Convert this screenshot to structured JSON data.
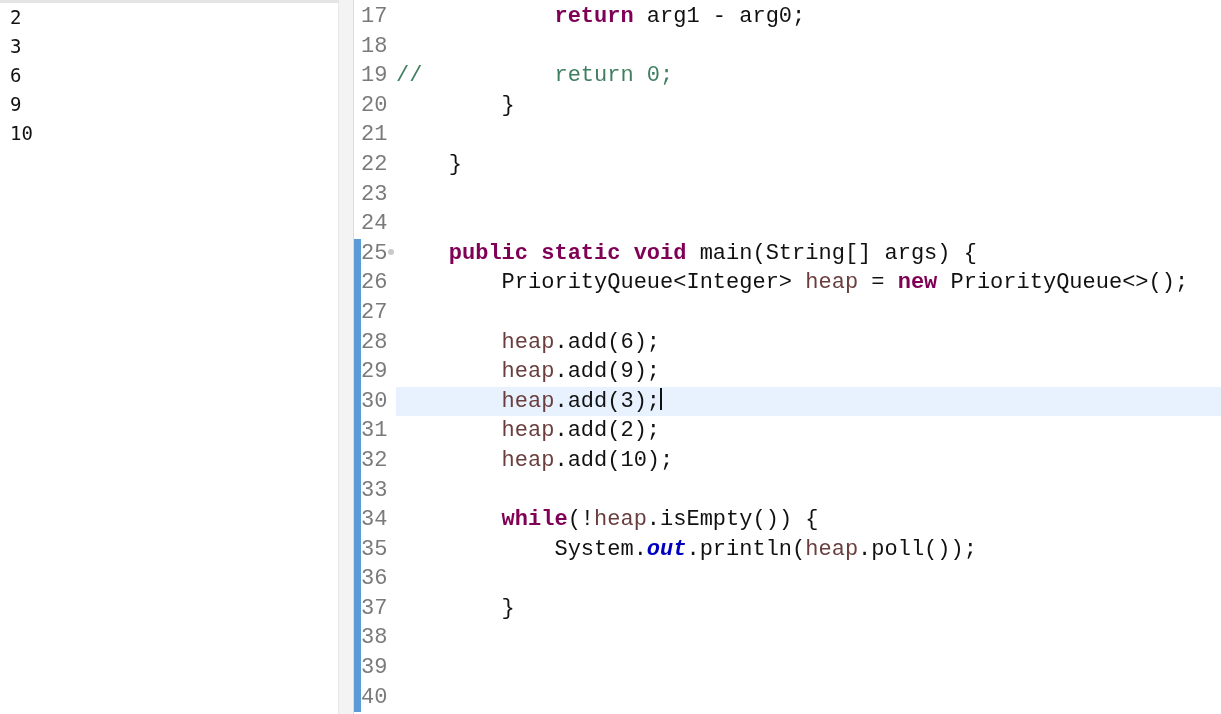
{
  "console": {
    "lines": [
      "2",
      "3",
      "6",
      "9",
      "10"
    ]
  },
  "editor": {
    "lines": [
      {
        "number": "17",
        "selected": false,
        "changed": false,
        "foldable": false,
        "tokens": [
          {
            "kind": "keyword",
            "text": "            return"
          },
          {
            "kind": "plain",
            "text": " arg1 - arg0;"
          }
        ]
      },
      {
        "number": "18",
        "selected": false,
        "changed": false,
        "foldable": false
      },
      {
        "number": "19",
        "selected": false,
        "changed": false,
        "foldable": false,
        "tokens": [
          {
            "kind": "comment",
            "text": "//          return 0;"
          }
        ]
      },
      {
        "number": "20",
        "selected": false,
        "changed": false,
        "foldable": false,
        "tokens": [
          {
            "kind": "plain",
            "text": "        }"
          }
        ]
      },
      {
        "number": "21",
        "selected": false,
        "changed": false,
        "foldable": false
      },
      {
        "number": "22",
        "selected": false,
        "changed": false,
        "foldable": false,
        "tokens": [
          {
            "kind": "plain",
            "text": "    }"
          }
        ]
      },
      {
        "number": "23",
        "selected": false,
        "changed": false,
        "foldable": false
      },
      {
        "number": "24",
        "selected": false,
        "changed": false,
        "foldable": false
      },
      {
        "number": "25",
        "selected": false,
        "changed": true,
        "foldable": true,
        "tokens": [
          {
            "kind": "keyword",
            "text": "    public static void"
          },
          {
            "kind": "plain",
            "text": " main(String[] args) {"
          }
        ]
      },
      {
        "number": "26",
        "selected": false,
        "changed": true,
        "foldable": false,
        "tokens": [
          {
            "kind": "plain",
            "text": "        PriorityQueue<Integer> "
          },
          {
            "kind": "local",
            "text": "heap"
          },
          {
            "kind": "plain",
            "text": " = "
          },
          {
            "kind": "keyword",
            "text": "new"
          },
          {
            "kind": "plain",
            "text": " PriorityQueue<>();"
          }
        ]
      },
      {
        "number": "27",
        "selected": false,
        "changed": true,
        "foldable": false
      },
      {
        "number": "28",
        "selected": false,
        "changed": true,
        "foldable": false,
        "tokens": [
          {
            "kind": "local",
            "text": "        heap"
          },
          {
            "kind": "plain",
            "text": ".add(6);"
          }
        ]
      },
      {
        "number": "29",
        "selected": false,
        "changed": true,
        "foldable": false,
        "tokens": [
          {
            "kind": "local",
            "text": "        heap"
          },
          {
            "kind": "plain",
            "text": ".add(9);"
          }
        ]
      },
      {
        "number": "30",
        "selected": true,
        "changed": true,
        "foldable": false,
        "tokens": [
          {
            "kind": "local",
            "text": "        heap"
          },
          {
            "kind": "plain",
            "text": ".add(3);"
          }
        ]
      },
      {
        "number": "31",
        "selected": false,
        "changed": true,
        "foldable": false,
        "tokens": [
          {
            "kind": "local",
            "text": "        heap"
          },
          {
            "kind": "plain",
            "text": ".add(2);"
          }
        ]
      },
      {
        "number": "32",
        "selected": false,
        "changed": true,
        "foldable": false,
        "tokens": [
          {
            "kind": "local",
            "text": "        heap"
          },
          {
            "kind": "plain",
            "text": ".add(10);"
          }
        ]
      },
      {
        "number": "33",
        "selected": false,
        "changed": true,
        "foldable": false
      },
      {
        "number": "34",
        "selected": false,
        "changed": true,
        "foldable": false,
        "tokens": [
          {
            "kind": "keyword",
            "text": "        while"
          },
          {
            "kind": "plain",
            "text": "(!"
          },
          {
            "kind": "local",
            "text": "heap"
          },
          {
            "kind": "plain",
            "text": ".isEmpty()) {"
          }
        ]
      },
      {
        "number": "35",
        "selected": false,
        "changed": true,
        "foldable": false,
        "tokens": [
          {
            "kind": "plain",
            "text": "            System."
          },
          {
            "kind": "field",
            "text": "out"
          },
          {
            "kind": "plain",
            "text": ".println("
          },
          {
            "kind": "local",
            "text": "heap"
          },
          {
            "kind": "plain",
            "text": ".poll());"
          }
        ]
      },
      {
        "number": "36",
        "selected": false,
        "changed": true,
        "foldable": false
      },
      {
        "number": "37",
        "selected": false,
        "changed": true,
        "foldable": false,
        "tokens": [
          {
            "kind": "plain",
            "text": "        }"
          }
        ]
      },
      {
        "number": "38",
        "selected": false,
        "changed": true,
        "foldable": false
      },
      {
        "number": "39",
        "selected": false,
        "changed": true,
        "foldable": false
      },
      {
        "number": "40",
        "selected": false,
        "changed": true,
        "foldable": false
      }
    ]
  }
}
